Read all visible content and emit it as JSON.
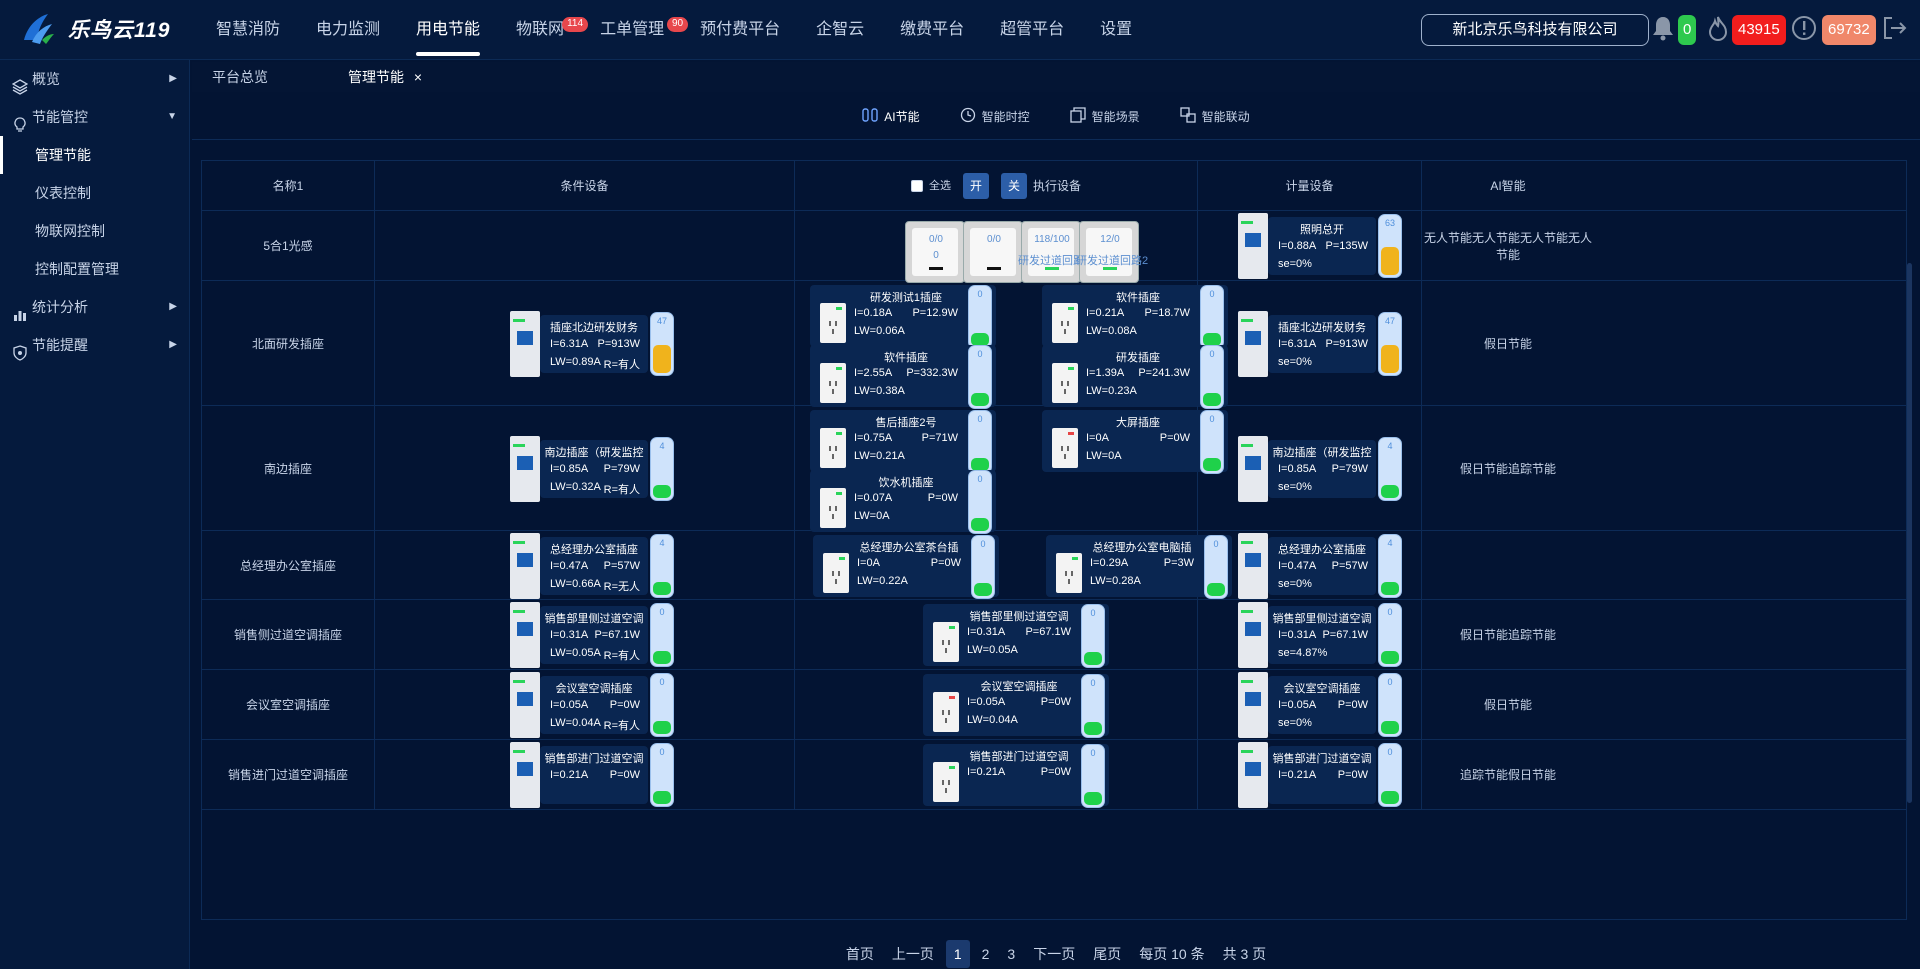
{
  "brand": {
    "name": "乐鸟云119"
  },
  "nav": [
    {
      "label": "智慧消防"
    },
    {
      "label": "电力监测"
    },
    {
      "label": "用电节能"
    },
    {
      "label": "物联网",
      "badge": "114"
    },
    {
      "label": "工单管理",
      "badge": "90"
    },
    {
      "label": "预付费平台"
    },
    {
      "label": "企智云"
    },
    {
      "label": "缴费平台"
    },
    {
      "label": "超管平台"
    },
    {
      "label": "设置"
    }
  ],
  "company": "新北京乐鸟科技有限公司",
  "counters": {
    "bell": "0",
    "fire": "43915",
    "alert": "69732"
  },
  "sidebar": {
    "overview": "概览",
    "energy": "节能管控",
    "subs": [
      "管理节能",
      "仪表控制",
      "物联网控制",
      "控制配置管理"
    ],
    "stats": "统计分析",
    "remind": "节能提醒"
  },
  "tabs": {
    "t1": "平台总览",
    "t2": "管理节能",
    "close": "×"
  },
  "subtabs": [
    "AI节能",
    "智能时控",
    "智能场景",
    "智能联动"
  ],
  "header": {
    "name": "名称1",
    "cond": "条件设备",
    "select_all": "全选",
    "on": "开",
    "off": "关",
    "exec": "执行设备",
    "meter": "计量设备",
    "ai": "AI智能"
  },
  "rows": [
    {
      "name": "5合1光感",
      "switches": [
        {
          "t1": "0/0",
          "t2": "0"
        },
        {
          "t1": "0/0",
          "t2": ""
        },
        {
          "t1": "118/100",
          "t2": "",
          "cap": "研发过道回路"
        },
        {
          "t1": "12/0",
          "t2": "",
          "cap": "研发过道回路2"
        }
      ],
      "meter": {
        "title": "照明总开",
        "i": "I=0.88A",
        "p": "P=135W",
        "l": "se=0%",
        "lv": "63"
      },
      "ai": "无人节能无人节能无人节能无人节能"
    },
    {
      "name": "北面研发插座",
      "cond": {
        "title": "插座北边研发财务",
        "i": "I=6.31A",
        "p": "P=913W",
        "l": "LW=0.89A",
        "r": "R=有人",
        "lv": "47"
      },
      "exec": [
        {
          "title": "研发测试1插座",
          "i": "I=0.18A",
          "p": "P=12.9W",
          "l": "LW=0.06A",
          "lv": "0"
        },
        {
          "title": "软件插座",
          "i": "I=0.21A",
          "p": "P=18.7W",
          "l": "LW=0.08A",
          "lv": "0"
        },
        {
          "title": "软件插座",
          "i": "I=2.55A",
          "p": "P=332.3W",
          "l": "LW=0.38A",
          "lv": "0"
        },
        {
          "title": "研发插座",
          "i": "I=1.39A",
          "p": "P=241.3W",
          "l": "LW=0.23A",
          "lv": "0"
        }
      ],
      "meter": {
        "title": "插座北边研发财务",
        "i": "I=6.31A",
        "p": "P=913W",
        "l": "se=0%",
        "lv": "47"
      },
      "ai": "假日节能"
    },
    {
      "name": "南边插座",
      "cond": {
        "title": "南边插座（研发监控",
        "i": "I=0.85A",
        "p": "P=79W",
        "l": "LW=0.32A",
        "r": "R=有人",
        "lv": "4"
      },
      "exec": [
        {
          "title": "售后插座2号",
          "i": "I=0.75A",
          "p": "P=71W",
          "l": "LW=0.21A",
          "lv": "0"
        },
        {
          "title": "大屏插座",
          "i": "I=0A",
          "p": "P=0W",
          "l": "LW=0A",
          "lv": "0"
        },
        {
          "title": "饮水机插座",
          "i": "I=0.07A",
          "p": "P=0W",
          "l": "LW=0A",
          "lv": "0"
        }
      ],
      "meter": {
        "title": "南边插座（研发监控",
        "i": "I=0.85A",
        "p": "P=79W",
        "l": "se=0%",
        "lv": "4"
      },
      "ai": "假日节能追踪节能"
    },
    {
      "name": "总经理办公室插座",
      "cond": {
        "title": "总经理办公室插座",
        "i": "I=0.47A",
        "p": "P=57W",
        "l": "LW=0.66A",
        "r": "R=无人",
        "lv": "4"
      },
      "exec": [
        {
          "title": "总经理办公室茶台插",
          "i": "I=0A",
          "p": "P=0W",
          "l": "LW=0.22A",
          "lv": "0"
        },
        {
          "title": "总经理办公室电脑插",
          "i": "I=0.29A",
          "p": "P=3W",
          "l": "LW=0.28A",
          "lv": "0"
        }
      ],
      "meter": {
        "title": "总经理办公室插座",
        "i": "I=0.47A",
        "p": "P=57W",
        "l": "se=0%",
        "lv": "4"
      },
      "ai": ""
    },
    {
      "name": "销售侧过道空调插座",
      "cond": {
        "title": "销售部里侧过道空调",
        "i": "I=0.31A",
        "p": "P=67.1W",
        "l": "LW=0.05A",
        "r": "R=有人",
        "lv": "0"
      },
      "exec": [
        {
          "title": "销售部里侧过道空调",
          "i": "I=0.31A",
          "p": "P=67.1W",
          "l": "LW=0.05A",
          "lv": "0"
        }
      ],
      "meter": {
        "title": "销售部里侧过道空调",
        "i": "I=0.31A",
        "p": "P=67.1W",
        "l": "se=4.87%",
        "lv": "0"
      },
      "ai": "假日节能追踪节能"
    },
    {
      "name": "会议室空调插座",
      "cond": {
        "title": "会议室空调插座",
        "i": "I=0.05A",
        "p": "P=0W",
        "l": "LW=0.04A",
        "r": "R=有人",
        "lv": "0"
      },
      "exec": [
        {
          "title": "会议室空调插座",
          "i": "I=0.05A",
          "p": "P=0W",
          "l": "LW=0.04A",
          "lv": "0"
        }
      ],
      "meter": {
        "title": "会议室空调插座",
        "i": "I=0.05A",
        "p": "P=0W",
        "l": "se=0%",
        "lv": "0"
      },
      "ai": "假日节能"
    },
    {
      "name": "销售进门过道空调插座",
      "cond": {
        "title": "销售部进门过道空调",
        "i": "I=0.21A",
        "p": "P=0W",
        "l": "",
        "r": "",
        "lv": "0"
      },
      "exec": [
        {
          "title": "销售部进门过道空调",
          "i": "I=0.21A",
          "p": "P=0W",
          "l": "",
          "lv": "0"
        }
      ],
      "meter": {
        "title": "销售部进门过道空调",
        "i": "I=0.21A",
        "p": "P=0W",
        "l": "",
        "lv": "0"
      },
      "ai": "追踪节能假日节能"
    }
  ],
  "pager": {
    "first": "首页",
    "prev": "上一页",
    "pages": [
      "1",
      "2",
      "3"
    ],
    "next": "下一页",
    "last": "尾页",
    "size": "每页 10 条",
    "total": "共 3 页"
  }
}
